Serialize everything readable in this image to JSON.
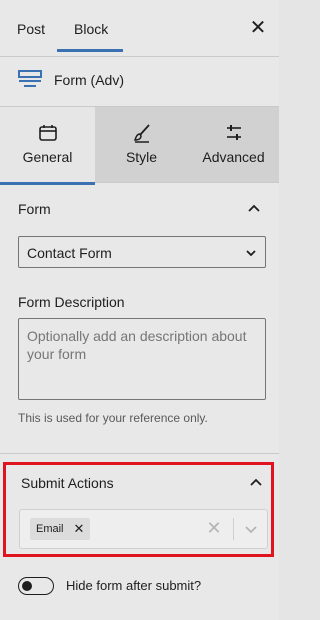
{
  "header": {
    "tabs": [
      {
        "label": "Post"
      },
      {
        "label": "Block"
      }
    ],
    "active_tab": "Block",
    "close_icon": "close-icon"
  },
  "block": {
    "icon": "form-block-icon",
    "name": "Form (Adv)"
  },
  "settings_tabs": [
    {
      "label": "General",
      "icon": "calendar-icon",
      "active": true
    },
    {
      "label": "Style",
      "icon": "brush-icon",
      "active": false
    },
    {
      "label": "Advanced",
      "icon": "sliders-icon",
      "active": false
    }
  ],
  "form_section": {
    "title": "Form",
    "select_value": "Contact Form",
    "description_label": "Form Description",
    "description_placeholder": "Optionally add an description about your form",
    "help_text": "This is used for your reference only."
  },
  "submit_section": {
    "title": "Submit Actions",
    "tokens": [
      {
        "label": "Email"
      }
    ],
    "clear_icon": "clear-icon",
    "dropdown_icon": "chevron-down-icon"
  },
  "toggle": {
    "label": "Hide form after submit?",
    "on": false
  },
  "colors": {
    "accent": "#3a71b1",
    "highlight": "#e0141e"
  }
}
